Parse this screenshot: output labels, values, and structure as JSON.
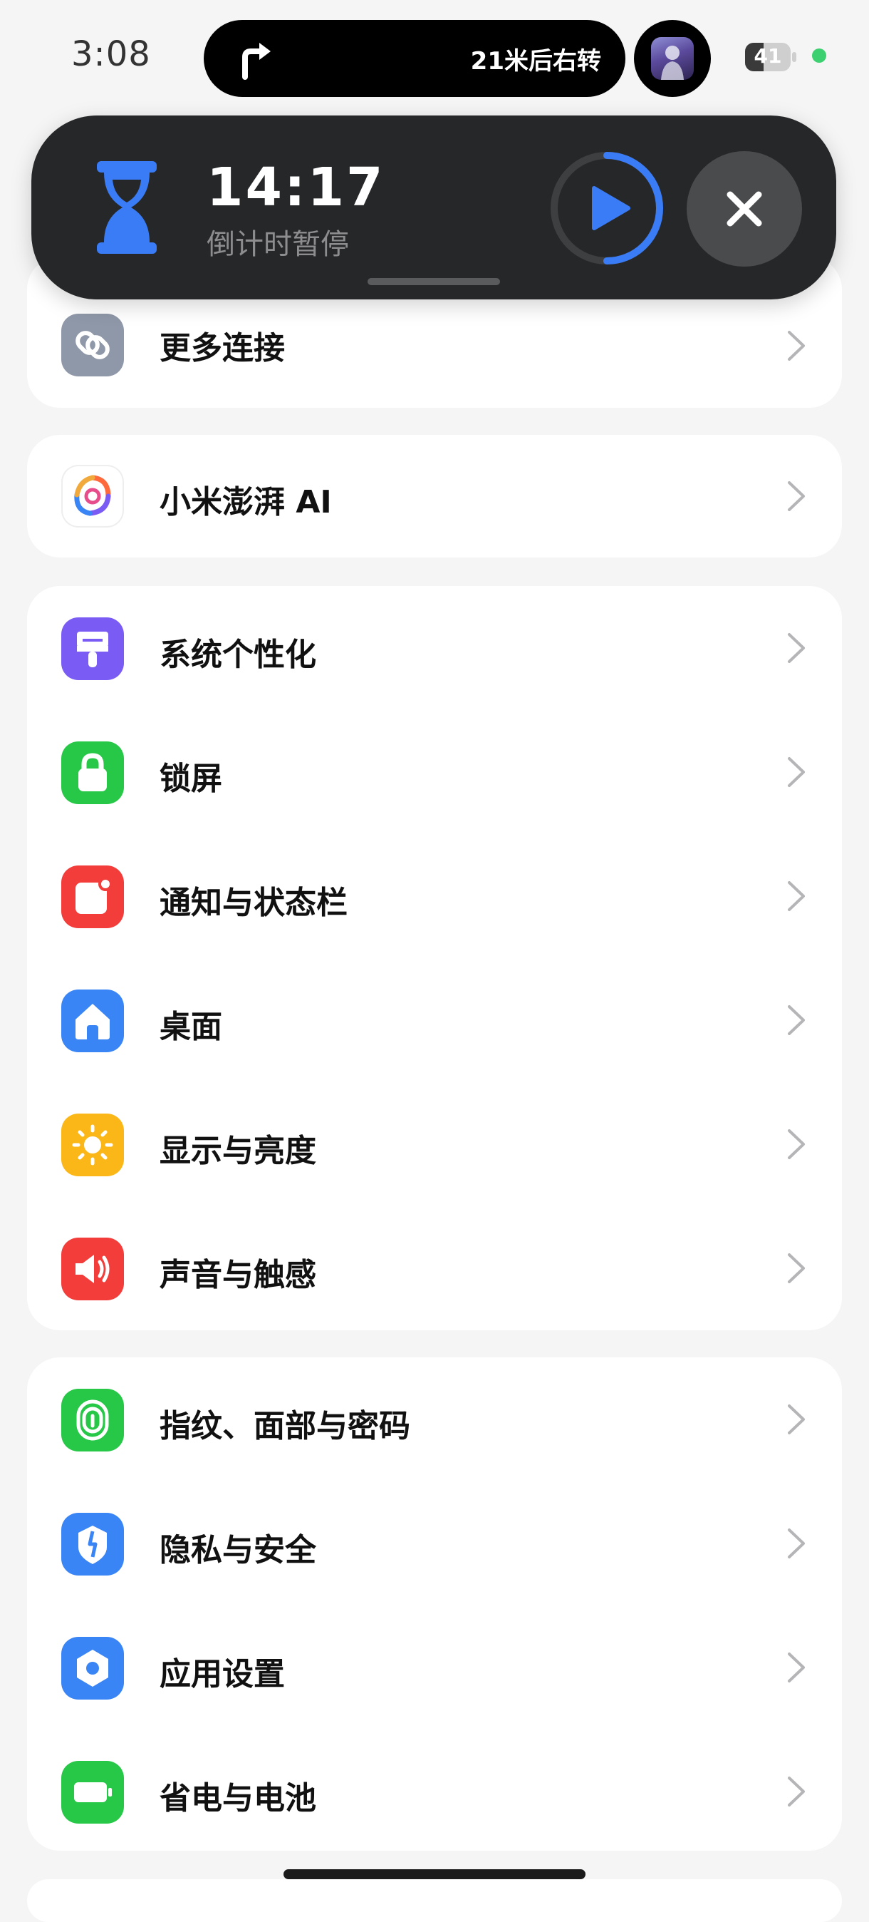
{
  "status_bar": {
    "time": "3:08",
    "nav_text": "21米后右转",
    "nav_icon": "turn-right-arrow-icon",
    "battery_percent": "41",
    "battery_level": 0.41,
    "charging_dot_color": "#3cd070"
  },
  "timer": {
    "time": "14:17",
    "status": "倒计时暂停",
    "progress": 0.5,
    "accent_color": "#3a7cf6",
    "icons": [
      "hourglass-icon",
      "play-icon",
      "close-icon"
    ]
  },
  "settings": {
    "group1": [
      {
        "label": "更多连接",
        "icon": "link-icon",
        "color": "#8f98a8"
      }
    ],
    "group2": [
      {
        "label": "小米澎湃 AI",
        "icon": "hyperos-ai-icon",
        "color": "#ffffff"
      }
    ],
    "group3": [
      {
        "label": "系统个性化",
        "icon": "brush-icon",
        "color": "#7a5cf5"
      },
      {
        "label": "锁屏",
        "icon": "lock-icon",
        "color": "#27c747"
      },
      {
        "label": "通知与状态栏",
        "icon": "notification-icon",
        "color": "#f23d3a"
      },
      {
        "label": "桌面",
        "icon": "home-icon",
        "color": "#3a85f5"
      },
      {
        "label": "显示与亮度",
        "icon": "sun-icon",
        "color": "#fbb717"
      },
      {
        "label": "声音与触感",
        "icon": "speaker-icon",
        "color": "#f23d3a"
      }
    ],
    "group4": [
      {
        "label": "指纹、面部与密码",
        "icon": "fingerprint-icon",
        "color": "#27c747"
      },
      {
        "label": "隐私与安全",
        "icon": "shield-icon",
        "color": "#3a85f5"
      },
      {
        "label": "应用设置",
        "icon": "hexagon-icon",
        "color": "#3a85f5"
      },
      {
        "label": "省电与电池",
        "icon": "battery-icon",
        "color": "#27c747"
      }
    ]
  }
}
